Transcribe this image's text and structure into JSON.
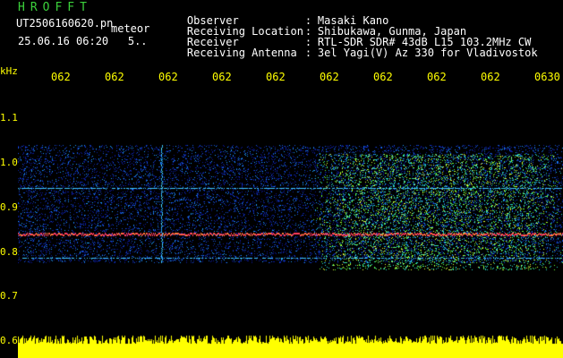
{
  "header": {
    "brand": "HROFFT",
    "file_name": "UT2506160620.pn",
    "mode": "meteor",
    "datetime": "25.06.16 06:20",
    "interval": "5.."
  },
  "station": {
    "rows": [
      {
        "label": "Observer",
        "sep": ":",
        "value": "Masaki Kano"
      },
      {
        "label": "Receiving Location",
        "sep": ":",
        "value": "Shibukawa, Gunma, Japan"
      },
      {
        "label": "Receiver",
        "sep": ":",
        "value": "RTL-SDR SDR# 43dB L15 103.2MHz CW"
      },
      {
        "label": "Receiving Antenna",
        "sep": ":",
        "value": "3el Yagi(V) Az 330 for Vladivostok"
      }
    ]
  },
  "axes": {
    "unit": "kHz",
    "y_ticks": [
      "1.1",
      "1.0",
      "0.9",
      "0.8",
      "0.7",
      "0.6"
    ],
    "x_ticks": [
      "062",
      "062",
      "062",
      "062",
      "062",
      "062",
      "062",
      "062",
      "062",
      "0630"
    ]
  },
  "colors": {
    "brand": "#3bd13b",
    "axis_labels": "#ffff00",
    "background": "#000000",
    "noise_low": "#0a1a8f",
    "noise_mid": "#1a8cff",
    "signal": "#ff3b5c",
    "activity": "#7cff3a",
    "bottom_bar": "#ffff00"
  }
}
